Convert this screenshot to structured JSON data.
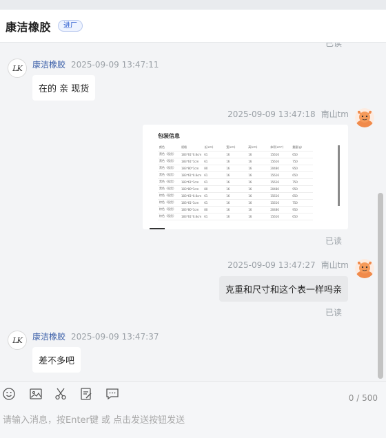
{
  "header": {
    "title": "康洁橡胶",
    "badge": "进厂"
  },
  "messages": [
    {
      "side": "left",
      "sender": "康洁橡胶",
      "time": "2025-09-09 13:47:11",
      "text": "在的 亲 现货"
    },
    {
      "side": "right",
      "sender": "南山tm",
      "time": "2025-09-09 13:47:18",
      "type": "image",
      "status": "已读",
      "image": {
        "caption": "包装信息",
        "columns": [
          "颜色",
          "规格",
          "长(cm)",
          "宽(cm)",
          "高(cm)",
          "体积(cm³)",
          "重量(g)"
        ],
        "rows": [
          [
            "黑色（现货）",
            "183*61*0.8cm",
            "61",
            "16",
            "16",
            "15616",
            "650"
          ],
          [
            "黑色（现货）",
            "183*61*1cm",
            "61",
            "16",
            "16",
            "15616",
            "750"
          ],
          [
            "黑色（现货）",
            "183*80*1cm",
            "80",
            "16",
            "16",
            "20480",
            "950"
          ],
          [
            "黑色（现货）",
            "183*61*0.8cm",
            "61",
            "16",
            "16",
            "15616",
            "650"
          ],
          [
            "黑色（现货）",
            "183*61*1cm",
            "61",
            "16",
            "16",
            "15616",
            "750"
          ],
          [
            "黑色（现货）",
            "183*80*1cm",
            "80",
            "16",
            "16",
            "20480",
            "950"
          ],
          [
            "棕色（现货）",
            "183*61*0.8cm",
            "61",
            "16",
            "16",
            "15616",
            "650"
          ],
          [
            "棕色（现货）",
            "183*61*1cm",
            "61",
            "16",
            "16",
            "15616",
            "750"
          ],
          [
            "棕色（现货）",
            "183*80*1cm",
            "80",
            "16",
            "16",
            "20480",
            "950"
          ],
          [
            "棕色（现货）",
            "183*61*0.8cm",
            "61",
            "16",
            "16",
            "15616",
            "650"
          ]
        ]
      }
    },
    {
      "side": "right",
      "sender": "南山tm",
      "time": "2025-09-09 13:47:27",
      "text": "克重和尺寸和这个表一样吗亲",
      "status": "已读"
    },
    {
      "side": "left",
      "sender": "康洁橡胶",
      "time": "2025-09-09 13:47:37",
      "text": "差不多吧"
    }
  ],
  "earlier_status": "已读",
  "avatars": {
    "left_initials": "LK",
    "right_icon": "cartoon-avatar"
  },
  "toolbar": {
    "icons": [
      "emoji-icon",
      "image-icon",
      "scissors-icon",
      "form-icon",
      "chat-bubble-icon"
    ],
    "counter": "0 / 500"
  },
  "input": {
    "placeholder": "请输入消息，按Enter键 或 点击发送按钮发送",
    "value": ""
  },
  "colors": {
    "sender_blue": "#3a5ea8",
    "gray_text": "#9aa0a6",
    "badge_blue": "#2f5fd0",
    "avatar_orange": "#f08a4b"
  }
}
